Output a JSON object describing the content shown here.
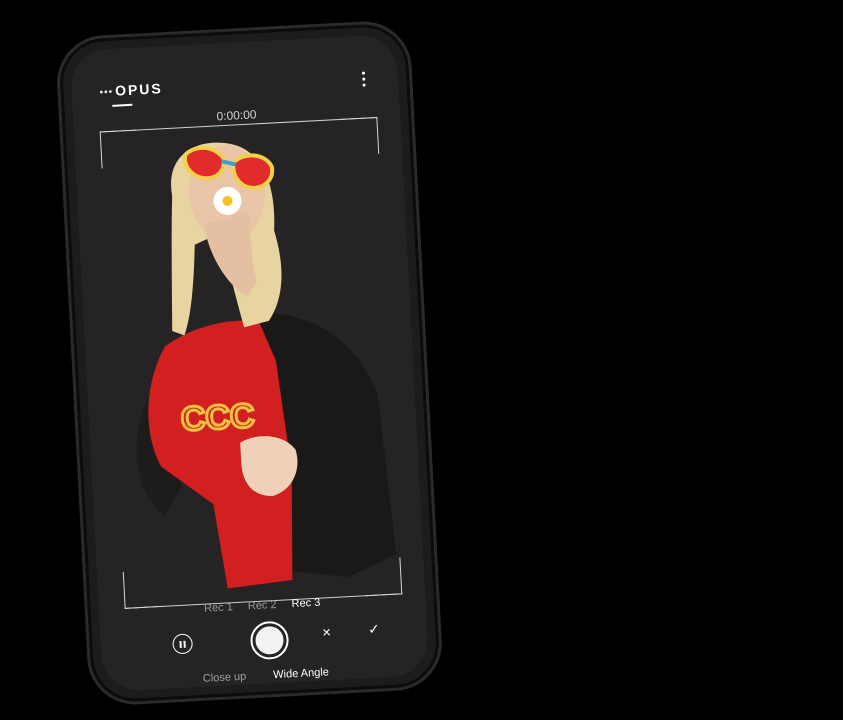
{
  "app": {
    "logo_text": "OPUS",
    "logo_dots": "•••"
  },
  "header": {
    "menu_icon": "more-vertical-icon"
  },
  "recording": {
    "timer": "0:00:00"
  },
  "takes": [
    {
      "label": "Rec 1",
      "active": false
    },
    {
      "label": "Rec 2",
      "active": false
    },
    {
      "label": "Rec 3",
      "active": true
    }
  ],
  "controls": {
    "pause_icon": "pause-icon",
    "shutter_icon": "record-shutter-icon",
    "close_glyph": "×",
    "confirm_glyph": "✓"
  },
  "lenses": [
    {
      "label": "Close up",
      "active": false
    },
    {
      "label": "Wide Angle",
      "active": true
    }
  ],
  "colors": {
    "sweater": "#d21f1f",
    "background": "#000000",
    "frame": "#1c1c1e"
  }
}
